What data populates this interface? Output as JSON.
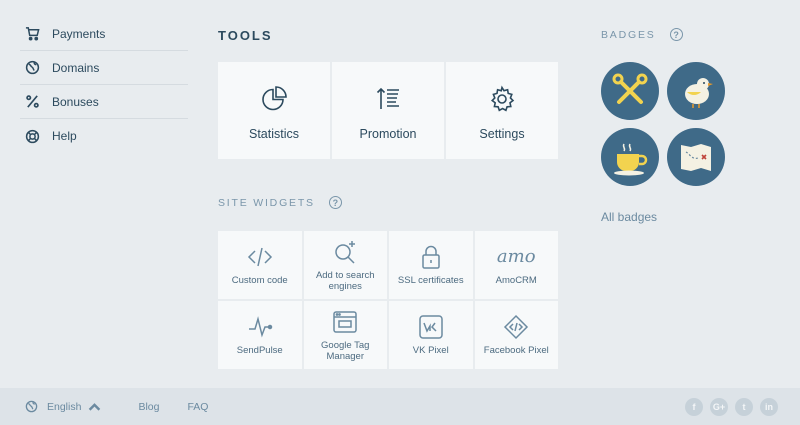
{
  "sidebar": {
    "items": [
      {
        "label": "Payments",
        "icon": "cart-icon"
      },
      {
        "label": "Domains",
        "icon": "globe-icon"
      },
      {
        "label": "Bonuses",
        "icon": "percent-icon"
      },
      {
        "label": "Help",
        "icon": "lifebuoy-icon"
      }
    ]
  },
  "tools": {
    "title": "TOOLS",
    "items": [
      {
        "label": "Statistics",
        "icon": "pie-chart-icon"
      },
      {
        "label": "Promotion",
        "icon": "sort-list-icon"
      },
      {
        "label": "Settings",
        "icon": "gear-icon"
      }
    ]
  },
  "widgets": {
    "title": "SITE WIDGETS",
    "help": "?",
    "items": [
      {
        "label": "Custom code",
        "icon": "code-icon"
      },
      {
        "label": "Add to search engines",
        "icon": "search-plus-icon"
      },
      {
        "label": "SSL certificates",
        "icon": "lock-icon"
      },
      {
        "label": "AmoCRM",
        "icon": "amo-logo",
        "logo_text": "amo"
      },
      {
        "label": "SendPulse",
        "icon": "pulse-icon"
      },
      {
        "label": "Google Tag Manager",
        "icon": "browser-icon"
      },
      {
        "label": "VK Pixel",
        "icon": "vk-icon"
      },
      {
        "label": "Facebook Pixel",
        "icon": "code-diamond-icon"
      }
    ]
  },
  "badges": {
    "title": "BADGES",
    "help": "?",
    "all_link": "All badges",
    "items": [
      "tools-badge",
      "bird-badge",
      "coffee-badge",
      "map-badge"
    ],
    "colors": {
      "circle": "#3f6a88",
      "accent": "#f2d34f"
    }
  },
  "footer": {
    "language": "English",
    "links": [
      "Blog",
      "FAQ"
    ],
    "socials": [
      {
        "name": "facebook",
        "glyph": "f"
      },
      {
        "name": "google-plus",
        "glyph": "G+"
      },
      {
        "name": "twitter",
        "glyph": "t"
      },
      {
        "name": "linkedin",
        "glyph": "in"
      }
    ]
  }
}
